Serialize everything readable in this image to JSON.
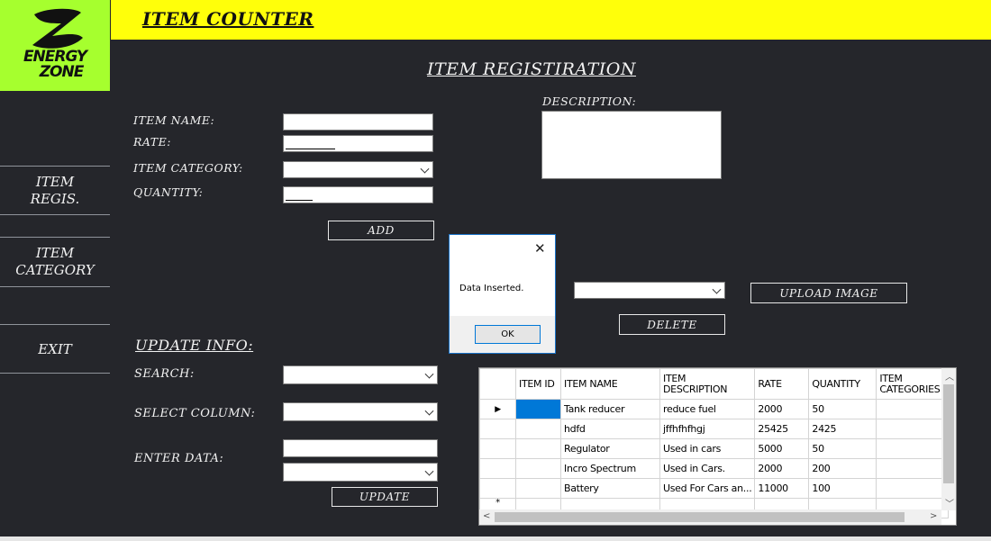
{
  "app": {
    "title": "ITEM COUNTER",
    "logo_line1": "ENERGY",
    "logo_line2": "ZONE"
  },
  "sidebar": {
    "items": [
      {
        "line1": "ITEM",
        "line2": "REGIS."
      },
      {
        "line1": "ITEM",
        "line2": "CATEGORY"
      },
      {
        "line1": "EXIT",
        "line2": ""
      }
    ]
  },
  "registration": {
    "heading": "ITEM REGISTIRATION",
    "item_name_label": "ITEM NAME:",
    "rate_label": "RATE:",
    "item_category_label": "ITEM CATEGORY:",
    "quantity_label": "QUANTITY:",
    "description_label": "DESCRIPTION:",
    "add_button": "ADD",
    "upload_image_button": "UPLOAD IMAGE",
    "delete_button": "DELETE"
  },
  "update": {
    "heading": "UPDATE INFO:",
    "search_label": "SEARCH:",
    "select_column_label": "SELECT COLUMN:",
    "enter_data_label": "ENTER DATA:",
    "update_button": "UPDATE"
  },
  "dialog": {
    "close": "✕",
    "message": "Data Inserted.",
    "ok": "OK"
  },
  "grid": {
    "columns": [
      "ITEM ID",
      "ITEM  NAME",
      "ITEM DESCRIPTION",
      "RATE",
      "QUANTITY",
      "ITEM CATEGORIES"
    ],
    "rows": [
      [
        "",
        "Tank reducer",
        "reduce fuel",
        "2000",
        "50",
        ""
      ],
      [
        "",
        "hdfd",
        "jffhfhfhgj",
        "25425",
        "2425",
        ""
      ],
      [
        "",
        "Regulator",
        "Used in cars",
        "5000",
        "50",
        ""
      ],
      [
        "",
        "Incro Spectrum",
        "Used in Cars.",
        "2000",
        "200",
        ""
      ],
      [
        "",
        "Battery",
        "Used For Cars an...",
        "11000",
        "100",
        ""
      ]
    ],
    "current_row_marker": "▶",
    "new_row_marker": "*"
  }
}
